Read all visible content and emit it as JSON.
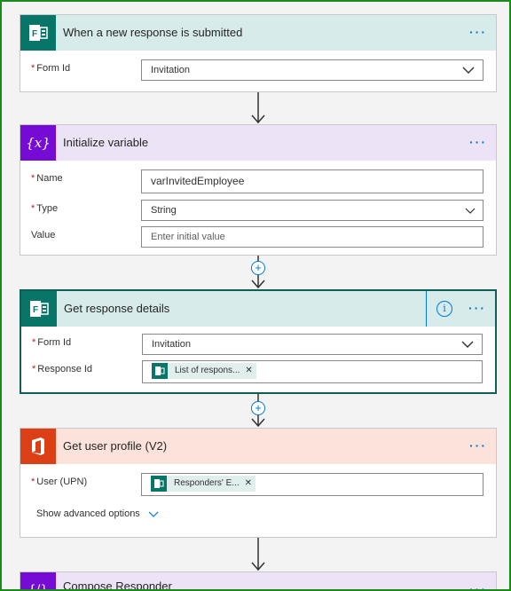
{
  "cards": {
    "trigger": {
      "title": "When a new response is submitted",
      "form_id_label": "Form Id",
      "form_id_value": "Invitation",
      "accent": "#d7ecea"
    },
    "init_var": {
      "title": "Initialize variable",
      "name_label": "Name",
      "name_value": "varInvitedEmployee",
      "type_label": "Type",
      "type_value": "String",
      "value_label": "Value",
      "value_placeholder": "Enter initial value",
      "accent": "#ece3f6"
    },
    "get_response": {
      "title": "Get response details",
      "form_id_label": "Form Id",
      "form_id_value": "Invitation",
      "response_id_label": "Response Id",
      "response_token": "List of respons...",
      "accent": "#d7ecea"
    },
    "user_profile": {
      "title": "Get user profile (V2)",
      "upn_label": "User (UPN)",
      "upn_token": "Responders' E...",
      "advanced_link": "Show advanced options",
      "accent": "#fbe3dc"
    },
    "compose": {
      "title": "Compose Responder",
      "accent": "#ece3f6"
    }
  },
  "icons": {
    "more": "more-icon",
    "chevron": "chevron-down-icon",
    "plus": "add-step-icon",
    "info": "info-icon",
    "remove": "remove-token-icon"
  },
  "colors": {
    "forms": "#077568",
    "variable": "#770bd6",
    "office": "#dc3e15",
    "link": "#0078d4",
    "frame": "#1a8a1a"
  }
}
